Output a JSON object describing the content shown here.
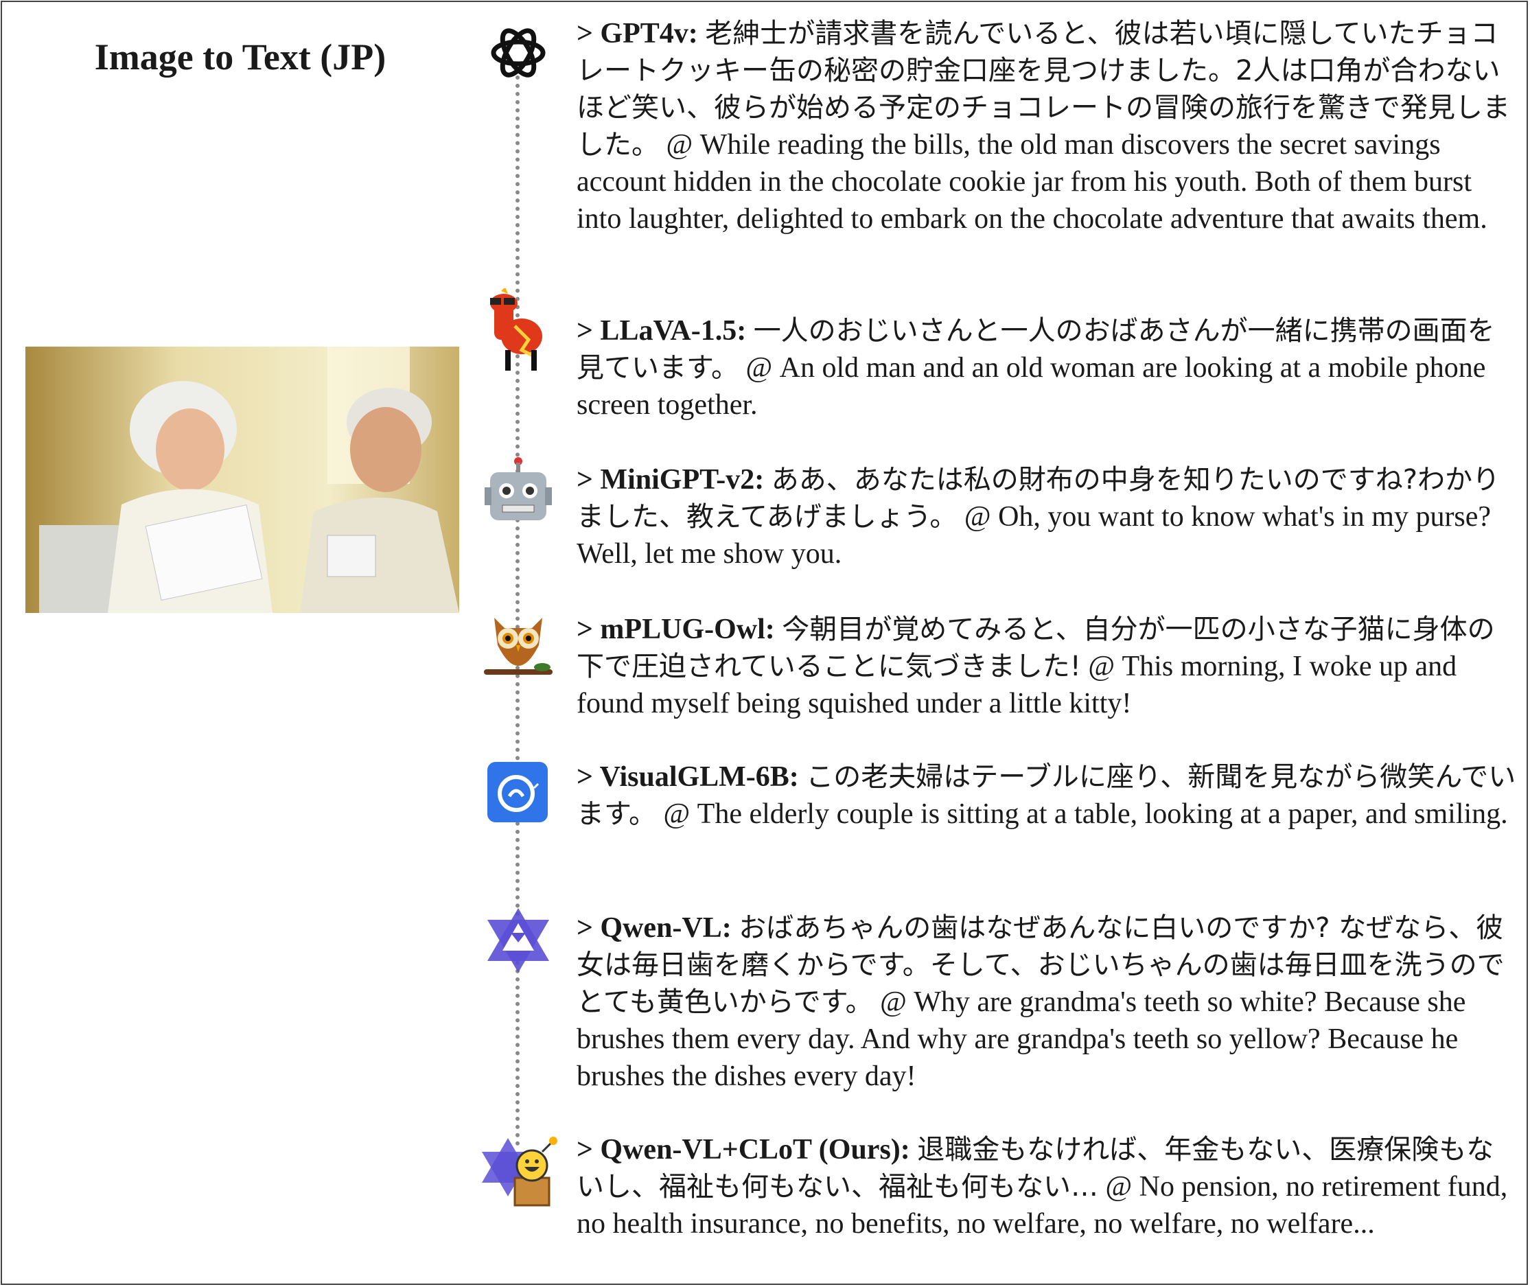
{
  "title": "Image to Text (JP)",
  "entries": [
    {
      "model": "> GPT4v:",
      "jp": "老紳士が請求書を読んでいると、彼は若い頃に隠していたチョコレートクッキー缶の秘密の貯金口座を見つけました。2人は口角が合わないほど笑い、彼らが始める予定のチョコレートの冒険の旅行を驚きで発見しました。",
      "en": "@ While reading the bills, the old man discovers the secret savings account hidden in the chocolate cookie jar from his youth. Both of them burst into laughter, delighted to embark on the chocolate adventure that awaits them.",
      "icon": "openai-icon"
    },
    {
      "model": "> LLaVA-1.5:",
      "jp": "一人のおじいさんと一人のおばあさんが一緒に携帯の画面を見ています。",
      "en": "@ An old man and an old woman are looking at a mobile phone screen together.",
      "icon": "llama-icon"
    },
    {
      "model": "> MiniGPT-v2:",
      "jp": "ああ、あなたは私の財布の中身を知りたいのですね?わかりました、教えてあげましょう。",
      "en": "@ Oh, you want to know what's in my purse? Well, let me show you.",
      "icon": "robot-icon"
    },
    {
      "model": "> mPLUG-Owl:",
      "jp": "今朝目が覚めてみると、自分が一匹の小さな子猫に身体の下で圧迫されていることに気づきました!",
      "en": "@ This morning, I woke up and found myself being squished under a little kitty!",
      "icon": "owl-icon"
    },
    {
      "model": "> VisualGLM-6B:",
      "jp": "この老夫婦はテーブルに座り、新聞を見ながら微笑んでいます。",
      "en": "@ The elderly couple is sitting at a table, looking at a paper, and smiling.",
      "icon": "visualglm-icon"
    },
    {
      "model": "> Qwen-VL:",
      "jp": "おばあちゃんの歯はなぜあんなに白いのですか? なぜなら、彼女は毎日歯を磨くからです。そして、おじいちゃんの歯は毎日皿を洗うのでとても黄色いからです。",
      "en": "@ Why are grandma's teeth so white? Because she brushes them every day. And why are grandpa's teeth so yellow? Because he brushes the dishes every day!",
      "icon": "qwen-icon"
    },
    {
      "model": "> Qwen-VL+CLoT (Ours):",
      "jp": "退職金もなければ、年金もない、医療保険もないし、福祉も何もない、福祉も何もない…",
      "en": "@ No pension, no retirement fund, no health insurance, no benefits, no welfare, no welfare, no welfare...",
      "icon": "clot-icon"
    }
  ]
}
